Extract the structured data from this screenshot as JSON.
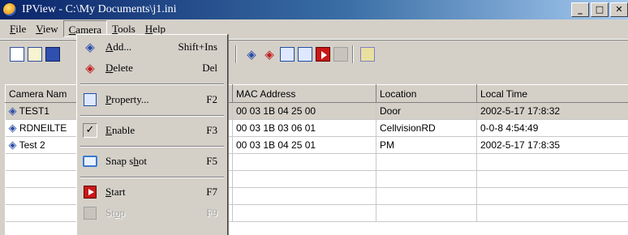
{
  "window": {
    "title": "IPView - C:\\My Documents\\j1.ini",
    "minimize_icon": "minimize-icon",
    "maximize_icon": "maximize-icon",
    "close_icon": "close-icon"
  },
  "menubar": {
    "items": [
      {
        "key": "F",
        "rest": "ile"
      },
      {
        "key": "V",
        "rest": "iew"
      },
      {
        "key": "C",
        "rest": "amera"
      },
      {
        "key": "T",
        "rest": "ools"
      },
      {
        "key": "H",
        "rest": "elp"
      }
    ]
  },
  "camera_menu": {
    "items": [
      {
        "label_key": "A",
        "label_rest": "dd...",
        "shortcut": "Shift+Ins",
        "icon": "camera-add-icon"
      },
      {
        "label_key": "D",
        "label_rest": "elete",
        "shortcut": "Del",
        "icon": "camera-delete-icon"
      },
      {
        "label_key": "P",
        "label_rest": "roperty...",
        "shortcut": "F2",
        "icon": "property-icon"
      },
      {
        "label_key": "E",
        "label_rest": "nable",
        "shortcut": "F3",
        "icon": "check-icon"
      },
      {
        "label_pre": "Snap s",
        "label_key": "h",
        "label_rest": "ot",
        "shortcut": "F5",
        "icon": "snapshot-icon"
      },
      {
        "label_key": "S",
        "label_rest": "tart",
        "shortcut": "F7",
        "icon": "start-icon"
      },
      {
        "label_pre": "St",
        "label_key": "o",
        "label_rest": "p",
        "shortcut": "F9",
        "icon": "stop-icon",
        "disabled": true
      }
    ]
  },
  "table": {
    "columns": [
      "Camera Nam",
      "MAC Address",
      "Location",
      "Local Time"
    ],
    "rows": [
      {
        "name": "TEST1",
        "mac": "00 03 1B 04 25 00",
        "location": "Door",
        "time": "2002-5-17  17:8:32",
        "selected": true
      },
      {
        "name": "RDNEILTE",
        "mac": "00 03 1B 03 06 01",
        "location": "CellvisionRD",
        "time": "0-0-8  4:54:49"
      },
      {
        "name": "Test 2",
        "mac": "00 03 1B 04 25 01",
        "location": "PM",
        "time": "2002-5-17  17:8:35"
      }
    ]
  }
}
